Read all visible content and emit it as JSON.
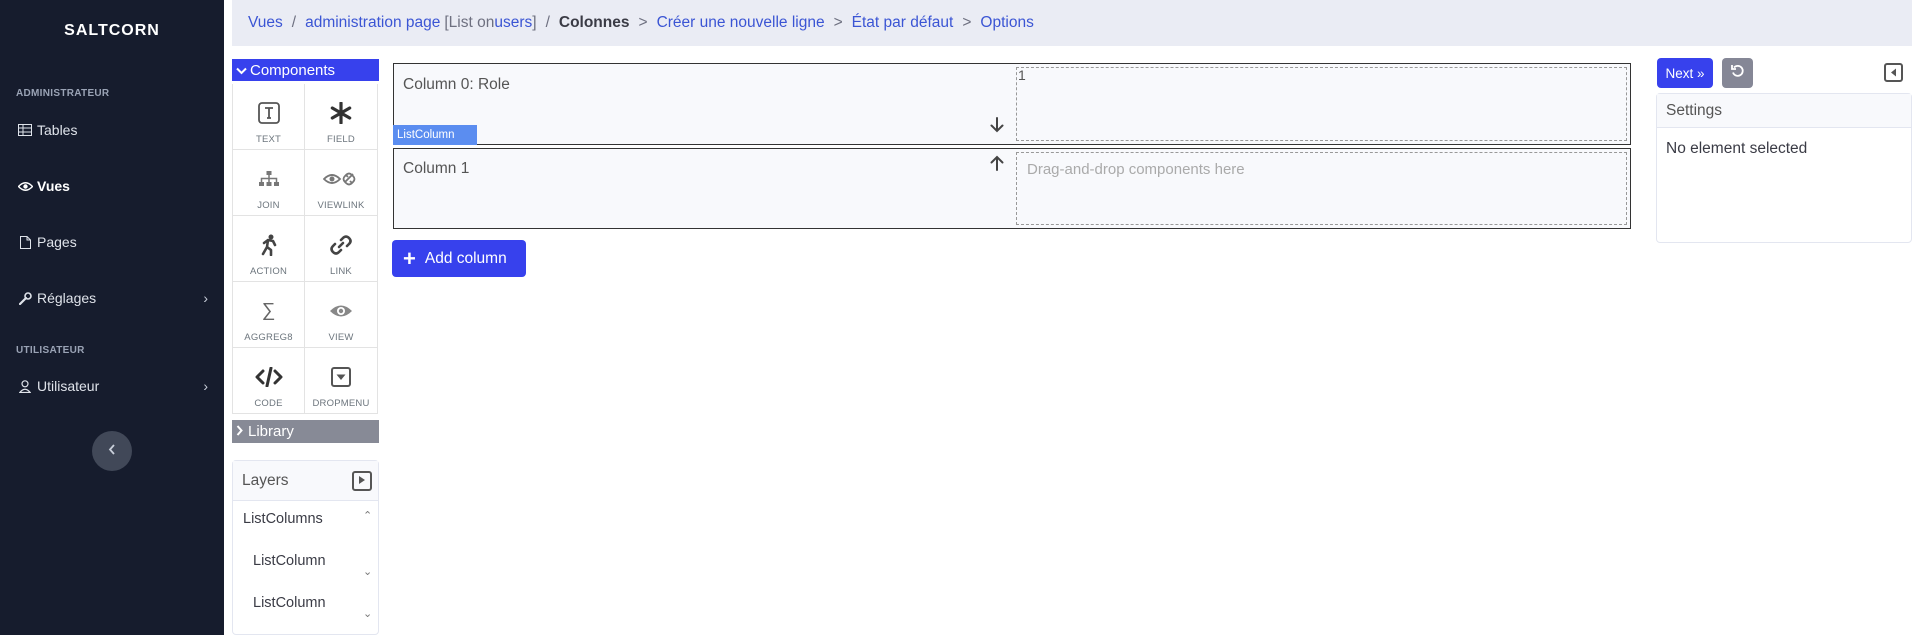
{
  "sidebar": {
    "brand": "SALTCORN",
    "sections": {
      "admin": "ADMINISTRATEUR",
      "user": "UTILISATEUR"
    },
    "items": [
      {
        "label": "Tables",
        "icon": "table-icon"
      },
      {
        "label": "Vues",
        "icon": "eye-icon",
        "active": true
      },
      {
        "label": "Pages",
        "icon": "file-icon"
      },
      {
        "label": "Réglages",
        "icon": "wrench-icon"
      },
      {
        "label": "Utilisateur",
        "icon": "user-icon"
      }
    ]
  },
  "breadcrumb": {
    "vues": "Vues",
    "sep": "/",
    "page": "administration page",
    "ctx_open": "[List on ",
    "ctx_link": "users",
    "ctx_close": "]",
    "colonnes": "Colonnes",
    "step_sep": ">",
    "step1": "Créer une nouvelle ligne",
    "step2": "État par défaut",
    "step3": "Options"
  },
  "palette": {
    "header": "Components",
    "items": [
      "TEXT",
      "FIELD",
      "JOIN",
      "VIEWLINK",
      "ACTION",
      "LINK",
      "AGGREG8",
      "VIEW",
      "CODE",
      "DROPMENU"
    ],
    "library": "Library"
  },
  "layers": {
    "header": "Layers",
    "root": "ListColumns",
    "children": [
      "ListColumn",
      "ListColumn"
    ]
  },
  "canvas": {
    "col0_title": "Column 0: Role",
    "col0_drop": "1",
    "tag": "ListColumn",
    "col1_title": "Column 1",
    "col1_drop": "Drag-and-drop components here",
    "add_column": "Add column"
  },
  "right": {
    "next": "Next »",
    "settings_title": "Settings",
    "settings_empty": "No element selected"
  },
  "colors": {
    "primary": "#3741ed",
    "sidebar": "#161c2d",
    "secondary": "#858796"
  }
}
